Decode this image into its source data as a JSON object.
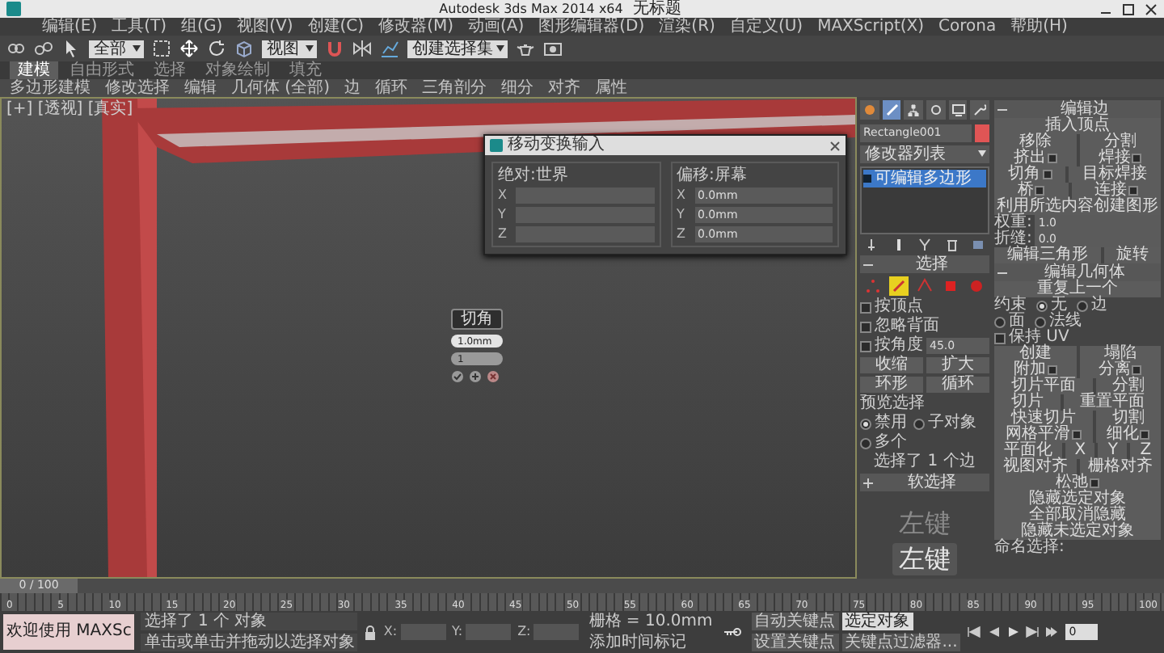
{
  "title_bar": {
    "app": "Autodesk 3ds Max 2014 x64",
    "document": "无标题"
  },
  "menu": [
    "编辑(E)",
    "工具(T)",
    "组(G)",
    "视图(V)",
    "创建(C)",
    "修改器(M)",
    "动画(A)",
    "图形编辑器(D)",
    "渲染(R)",
    "自定义(U)",
    "MAXScript(X)",
    "Corona",
    "帮助(H)"
  ],
  "toolbar": {
    "selection_filter": "全部",
    "coord_system": "视图",
    "named_selection": "创建选择集"
  },
  "ribbon_tabs": [
    {
      "label": "建模",
      "selected": true
    },
    {
      "label": "自由形式",
      "selected": false
    },
    {
      "label": "选择",
      "selected": false
    },
    {
      "label": "对象绘制",
      "selected": false
    },
    {
      "label": "填充",
      "selected": false
    }
  ],
  "ribbon_panels": [
    "多边形建模",
    "修改选择",
    "编辑",
    "几何体 (全部)",
    "边",
    "循环",
    "三角剖分",
    "细分",
    "对齐",
    "属性"
  ],
  "viewport": {
    "label": "[+] [透视] [真实]"
  },
  "transform_dialog": {
    "title": "移动变换输入",
    "groups": [
      {
        "title": "绝对:世界",
        "fields": [
          {
            "axis": "X"
          },
          {
            "axis": "Y"
          },
          {
            "axis": "Z"
          }
        ]
      },
      {
        "title": "偏移:屏幕",
        "fields": [
          {
            "axis": "X",
            "value": "0.0mm"
          },
          {
            "axis": "Y",
            "value": "0.0mm"
          },
          {
            "axis": "Z",
            "value": "0.0mm"
          }
        ]
      }
    ]
  },
  "caddy": {
    "title": "切角",
    "fields": [
      "1.0mm",
      "1"
    ]
  },
  "command_panel": {
    "tabs": [
      {
        "selected": false
      },
      {
        "selected": true
      },
      {
        "selected": false
      },
      {
        "selected": false
      },
      {
        "selected": false
      },
      {
        "selected": false
      }
    ],
    "object_name": "Rectangle001",
    "modifier_list": "修改器列表",
    "stack": [
      {
        "label": "可编辑多边形",
        "selected": true
      }
    ],
    "selection": {
      "title": "选择",
      "expanded": true,
      "levels": [
        {
          "selected": false
        },
        {
          "selected": true
        },
        {
          "selected": false
        },
        {
          "selected": false
        },
        {
          "selected": false
        }
      ],
      "options": [
        {
          "label": "按顶点",
          "checked": false
        },
        {
          "label": "忽略背面",
          "checked": false
        },
        {
          "label": "按角度",
          "checked": false,
          "value": "45.0"
        }
      ],
      "buttons": [
        [
          "收缩",
          "扩大"
        ],
        [
          "环形",
          "循环"
        ]
      ],
      "preview_title": "预览选择",
      "preview": [
        {
          "label": "禁用",
          "selected": true
        },
        {
          "label": "子对象",
          "selected": false
        },
        {
          "label": "多个",
          "selected": false
        }
      ],
      "status": "选择了 1 个边"
    },
    "soft_selection": {
      "title": "软选择",
      "expanded": false
    },
    "rollouts": [
      {
        "title": "编辑边",
        "expanded": true,
        "rows": [
          {
            "kind": "buttons",
            "items": [
              {
                "label": "插入顶点",
                "settings": false
              }
            ]
          },
          {
            "kind": "buttons",
            "items": [
              {
                "label": "移除",
                "settings": false
              },
              {
                "label": "分割",
                "settings": false
              }
            ]
          },
          {
            "kind": "buttons",
            "items": [
              {
                "label": "挤出",
                "settings": true
              },
              {
                "label": "焊接",
                "settings": true
              }
            ]
          },
          {
            "kind": "buttons",
            "items": [
              {
                "label": "切角",
                "settings": true
              },
              {
                "label": "目标焊接",
                "settings": false
              }
            ]
          },
          {
            "kind": "buttons",
            "items": [
              {
                "label": "桥",
                "settings": true
              },
              {
                "label": "连接",
                "settings": true
              }
            ]
          },
          {
            "kind": "buttons",
            "items": [
              {
                "label": "利用所选内容创建图形",
                "settings": false
              }
            ]
          },
          {
            "kind": "field",
            "label": "权重:",
            "value": "1.0"
          },
          {
            "kind": "field",
            "label": "折缝:",
            "value": "0.0"
          },
          {
            "kind": "buttons",
            "items": [
              {
                "label": "编辑三角形",
                "settings": false
              },
              {
                "label": "旋转",
                "settings": false
              }
            ]
          }
        ]
      },
      {
        "title": "编辑几何体",
        "expanded": true,
        "rows": [
          {
            "kind": "buttons",
            "items": [
              {
                "label": "重复上一个",
                "settings": false
              }
            ]
          },
          {
            "kind": "radios",
            "label": "约束",
            "items": [
              {
                "label": "无",
                "selected": true
              },
              {
                "label": "边",
                "selected": false
              }
            ]
          },
          {
            "kind": "radios",
            "items": [
              {
                "label": "面",
                "selected": false
              },
              {
                "label": "法线",
                "selected": false
              }
            ]
          },
          {
            "kind": "check",
            "label": "保持 UV",
            "checked": false
          },
          {
            "kind": "buttons",
            "items": [
              {
                "label": "创建",
                "settings": false
              },
              {
                "label": "塌陷",
                "settings": false
              }
            ]
          },
          {
            "kind": "buttons",
            "items": [
              {
                "label": "附加",
                "settings": true
              },
              {
                "label": "分离",
                "settings": true
              }
            ]
          },
          {
            "kind": "buttons",
            "items": [
              {
                "label": "切片平面",
                "settings": false
              },
              {
                "label": "分割",
                "settings": false
              }
            ]
          },
          {
            "kind": "buttons",
            "items": [
              {
                "label": "切片",
                "settings": false
              },
              {
                "label": "重置平面",
                "settings": false
              }
            ]
          },
          {
            "kind": "buttons",
            "items": [
              {
                "label": "快速切片",
                "settings": false
              },
              {
                "label": "切割",
                "settings": false
              }
            ]
          },
          {
            "kind": "buttons",
            "items": [
              {
                "label": "网格平滑",
                "settings": true
              },
              {
                "label": "细化",
                "settings": true
              }
            ]
          },
          {
            "kind": "buttons",
            "items": [
              {
                "label": "平面化",
                "settings": false
              },
              {
                "label": "X",
                "settings": false
              },
              {
                "label": "Y",
                "settings": false
              },
              {
                "label": "Z",
                "settings": false
              }
            ]
          },
          {
            "kind": "buttons",
            "items": [
              {
                "label": "视图对齐",
                "settings": false
              },
              {
                "label": "栅格对齐",
                "settings": false
              }
            ]
          },
          {
            "kind": "buttons",
            "items": [
              {
                "label": "松弛",
                "settings": true
              }
            ]
          },
          {
            "kind": "buttons",
            "items": [
              {
                "label": "隐藏选定对象",
                "settings": false
              }
            ]
          },
          {
            "kind": "buttons",
            "items": [
              {
                "label": "全部取消隐藏",
                "settings": false
              }
            ]
          },
          {
            "kind": "buttons",
            "items": [
              {
                "label": "隐藏未选定对象",
                "settings": false
              }
            ]
          },
          {
            "kind": "label",
            "label": "命名选择:"
          }
        ]
      }
    ]
  },
  "key_overlay": [
    {
      "label": "左键",
      "faded": true
    },
    {
      "label": "左键",
      "faded": false
    }
  ],
  "timeline": {
    "frame": "0 / 100",
    "level": 0,
    "ticks": [
      "0",
      "5",
      "10",
      "15",
      "20",
      "25",
      "30",
      "35",
      "40",
      "45",
      "50",
      "55",
      "60",
      "65",
      "70",
      "75",
      "80",
      "85",
      "90",
      "95",
      "100"
    ]
  },
  "status_bar": {
    "prompt": "欢迎使用 MAXSc",
    "message": "选择了 1 个 对象",
    "hint": "单击或单击并拖动以选择对象",
    "axes": [
      "X:",
      "Y:",
      "Z:"
    ],
    "grid": "栅格 = 10.0mm",
    "add_tag": "添加时间标记",
    "auto_key": "自动关键点",
    "key_mode": "选定对象",
    "set_key": "设置关键点",
    "key_filters": "关键点过滤器...",
    "frame": "0"
  }
}
